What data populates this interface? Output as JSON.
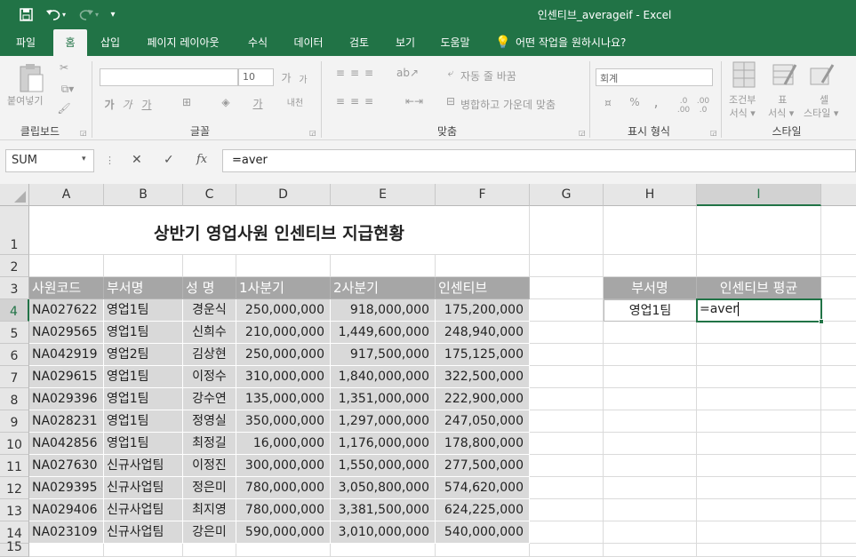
{
  "window": {
    "title": "인센티브_averageif  -  Excel"
  },
  "qat": {
    "save": "save-icon",
    "undo": "undo-icon",
    "redo": "redo-icon",
    "customize": "▾"
  },
  "tabs": [
    "파일",
    "홈",
    "삽입",
    "페이지 레이아웃",
    "수식",
    "데이터",
    "검토",
    "보기",
    "도움말"
  ],
  "tell_me": "어떤 작업을 원하시나요?",
  "ribbon": {
    "clipboard": {
      "paste": "붙여넣기",
      "label": "클립보드"
    },
    "font": {
      "name": "",
      "size": "10",
      "label": "글꼴",
      "grow": "가",
      "shrink": "가",
      "bold": "가",
      "italic": "가",
      "underline": "가",
      "phonetic": "내천"
    },
    "align": {
      "wrap": "자동 줄 바꿈",
      "merge": "병합하고 가운데 맞춤",
      "label": "맞춤"
    },
    "number": {
      "format": "회계",
      "label": "표시 형식",
      "percent": "%",
      "comma": ",",
      "inc": "←.0\n.00",
      "dec": ".00\n→.0"
    },
    "styles": {
      "cond": "조건부\n서식 ▾",
      "table": "표\n서식 ▾",
      "cell": "셀\n스타일 ▾",
      "label": "스타일"
    }
  },
  "formula_bar": {
    "name_box": "SUM",
    "formula": "=aver",
    "cancel": "✕",
    "enter": "✓",
    "fx": "fx"
  },
  "columns": [
    "A",
    "B",
    "C",
    "D",
    "E",
    "F",
    "G",
    "H",
    "I"
  ],
  "rows": [
    "1",
    "2",
    "3",
    "4",
    "5",
    "6",
    "7",
    "8",
    "9",
    "10",
    "11",
    "12",
    "13",
    "14",
    "15"
  ],
  "sheet": {
    "title": "상반기 영업사원 인센티브 지급현황",
    "headers": [
      "사원코드",
      "부서명",
      "성  명",
      "1사분기",
      "2사분기",
      "인센티브"
    ],
    "data": [
      [
        "NA027622",
        "영업1팀",
        "경운식",
        "250,000,000",
        "918,000,000",
        "175,200,000"
      ],
      [
        "NA029565",
        "영업1팀",
        "신희수",
        "210,000,000",
        "1,449,600,000",
        "248,940,000"
      ],
      [
        "NA042919",
        "영업2팀",
        "김상현",
        "250,000,000",
        "917,500,000",
        "175,125,000"
      ],
      [
        "NA029615",
        "영업1팀",
        "이정수",
        "310,000,000",
        "1,840,000,000",
        "322,500,000"
      ],
      [
        "NA029396",
        "영업1팀",
        "강수연",
        "135,000,000",
        "1,351,000,000",
        "222,900,000"
      ],
      [
        "NA028231",
        "영업1팀",
        "정영실",
        "350,000,000",
        "1,297,000,000",
        "247,050,000"
      ],
      [
        "NA042856",
        "영업1팀",
        "최정길",
        "16,000,000",
        "1,176,000,000",
        "178,800,000"
      ],
      [
        "NA027630",
        "신규사업팀",
        "이정진",
        "300,000,000",
        "1,550,000,000",
        "277,500,000"
      ],
      [
        "NA029395",
        "신규사업팀",
        "정은미",
        "780,000,000",
        "3,050,800,000",
        "574,620,000"
      ],
      [
        "NA029406",
        "신규사업팀",
        "최지영",
        "780,000,000",
        "3,381,500,000",
        "624,225,000"
      ],
      [
        "NA023109",
        "신규사업팀",
        "강은미",
        "590,000,000",
        "3,010,000,000",
        "540,000,000"
      ]
    ],
    "side_headers": [
      "부서명",
      "인센티브 평균"
    ],
    "side_dept": "영업1팀",
    "active_value": "=aver"
  },
  "colors": {
    "accent": "#217346",
    "header_fill": "#a6a6a6",
    "data_fill": "#d9d9d9"
  }
}
